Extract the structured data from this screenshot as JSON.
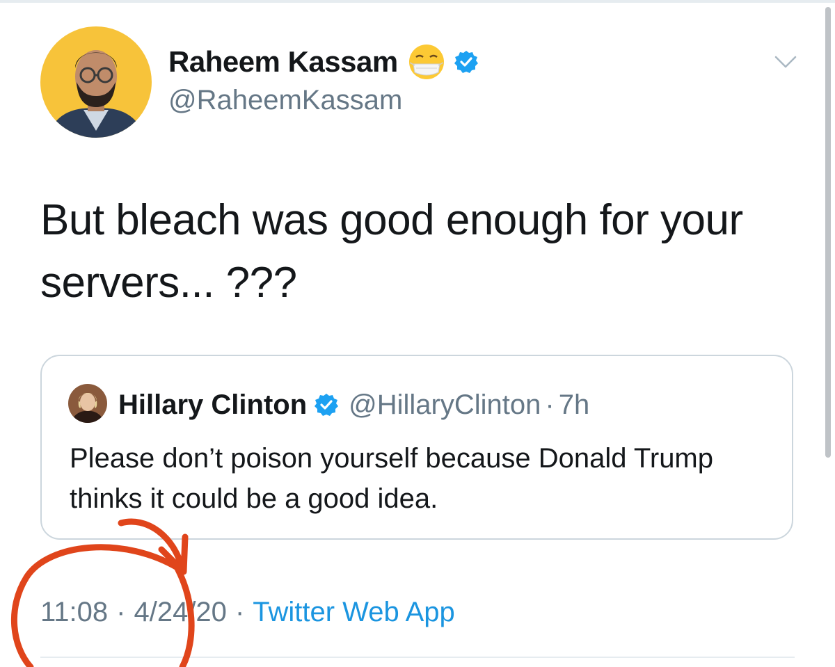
{
  "tweet": {
    "author": {
      "display_name": "Raheem Kassam",
      "handle": "@RaheemKassam",
      "emoji": "face-with-medical-mask",
      "verified": true
    },
    "text": "But bleach was good enough for your servers... ???",
    "quoted_tweet": {
      "display_name": "Hillary Clinton",
      "handle": "@HillaryClinton",
      "separator": "·",
      "time": "7h",
      "verified": true,
      "text": "Please don’t poison yourself because Donald Trump thinks it could be a good idea."
    },
    "meta": {
      "time": "11:08",
      "separator": "·",
      "date": "4/24/20",
      "source": "Twitter Web App"
    }
  },
  "icons": {
    "verified": "verified-badge-icon",
    "caret": "chevron-down-icon",
    "emoji": "mask-emoji-icon"
  },
  "colors": {
    "text_primary": "#14171a",
    "text_secondary": "#657786",
    "link": "#1b95e0",
    "verified": "#1da1f2",
    "border": "#ccd6dd",
    "annotation": "#e0451b",
    "avatar_bg": "#f7c33a"
  }
}
